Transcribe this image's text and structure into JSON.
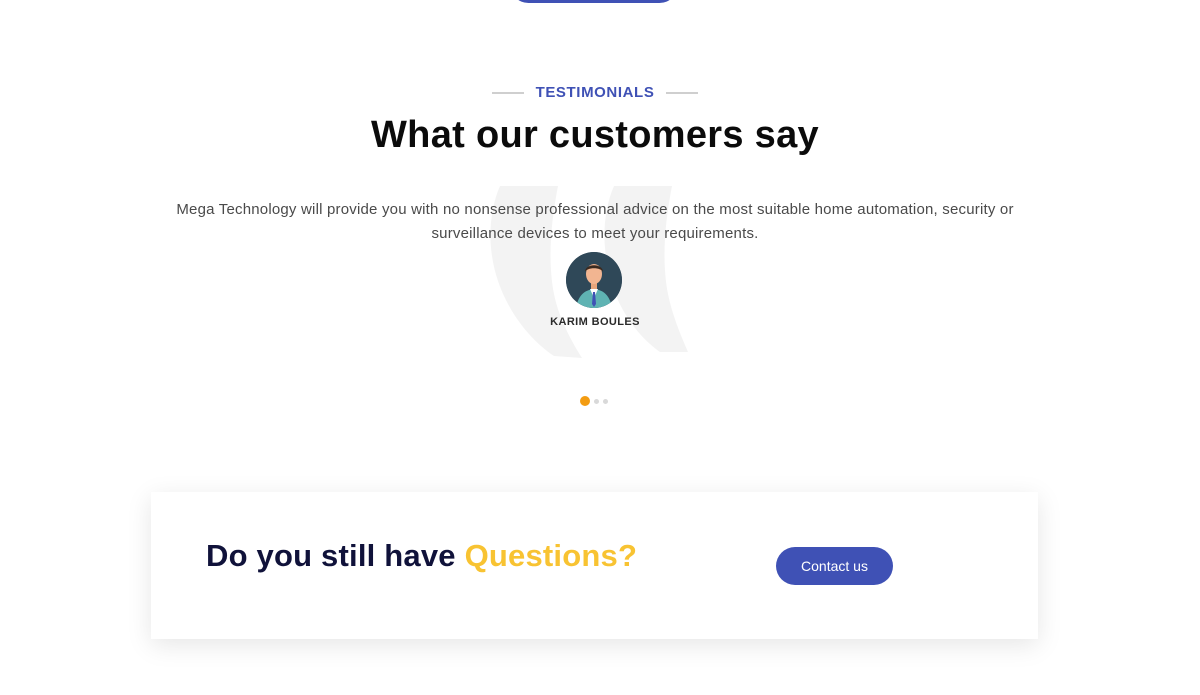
{
  "testimonials": {
    "eyebrow": "TESTIMONIALS",
    "title": "What our customers say",
    "items": [
      {
        "text": "Mega Technology will provide you with no nonsense professional advice on the most suitable home automation, security or surveillance devices to meet your requirements.",
        "author": "KARIM BOULES",
        "avatar_icon": "businessman-avatar-icon"
      }
    ],
    "active_slide": 1,
    "slide_count": 3
  },
  "cta": {
    "heading_prefix": "Do you still have ",
    "heading_accent": "Questions?",
    "button_label": "Contact us"
  },
  "colors": {
    "primary": "#3f51b5",
    "accent": "#f8c332",
    "dot_active": "#f39c12",
    "heading_dark": "#10123a"
  }
}
